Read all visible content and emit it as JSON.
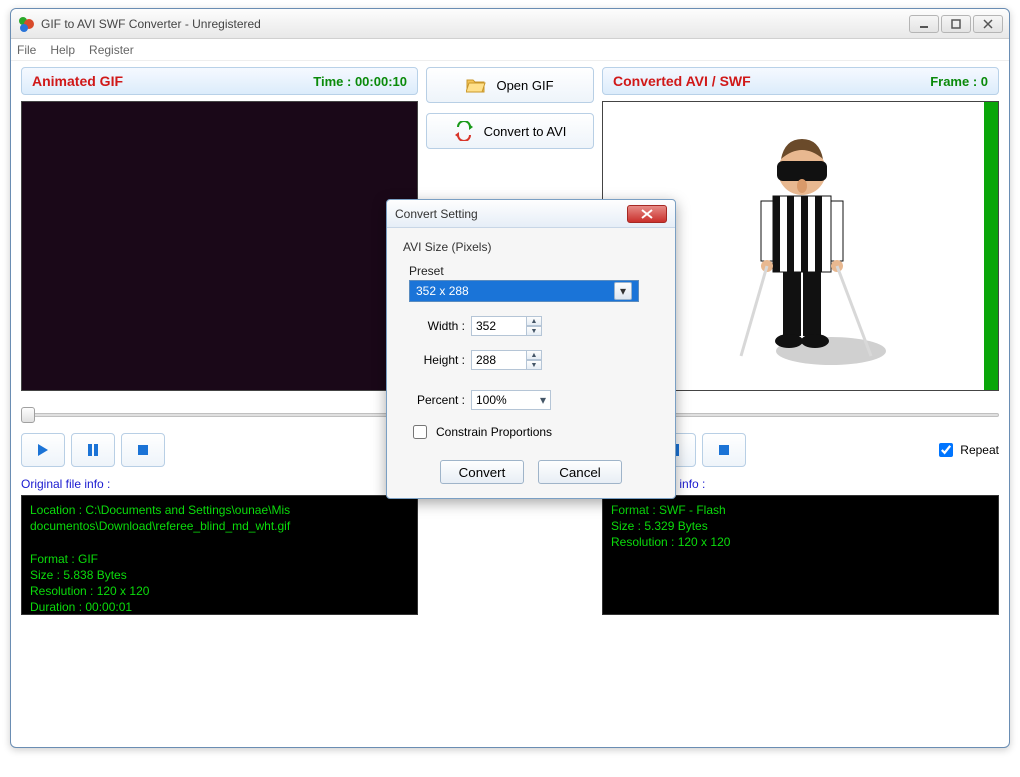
{
  "window": {
    "title": "GIF to AVI SWF Converter - Unregistered"
  },
  "menu": {
    "file": "File",
    "help": "Help",
    "register": "Register"
  },
  "leftPanel": {
    "title": "Animated GIF",
    "timeLabel": "Time :  00:00:10",
    "repeat": "Repeat",
    "infoLabel": "Original file info :",
    "infoText": "Location : C:\\Documents and Settings\\ounae\\Mis\ndocumentos\\Download\\referee_blind_md_wht.gif\n\nFormat : GIF\nSize : 5.838 Bytes\nResolution : 120 x 120\nDuration : 00:00:01"
  },
  "rightPanel": {
    "title": "Converted AVI / SWF",
    "frameLabel": "Frame :  0",
    "repeat": "Repeat",
    "infoLabel": "Converted file info :",
    "infoText": "Format : SWF - Flash\nSize : 5.329 Bytes\nResolution : 120 x 120"
  },
  "center": {
    "openGif": "Open  GIF",
    "convertToAvi": "Convert to AVI"
  },
  "dialog": {
    "title": "Convert Setting",
    "groupLabel": "AVI Size (Pixels)",
    "presetLabel": "Preset",
    "presetValue": "352 x 288",
    "widthLabel": "Width :",
    "widthValue": "352",
    "heightLabel": "Height :",
    "heightValue": "288",
    "percentLabel": "Percent :",
    "percentValue": "100%",
    "constrain": "Constrain Proportions",
    "convert": "Convert",
    "cancel": "Cancel"
  }
}
